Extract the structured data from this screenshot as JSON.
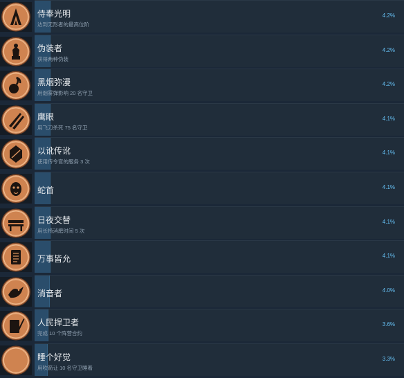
{
  "achievements": [
    {
      "title": "侍奉光明",
      "description": "达到无形者的最高位阶",
      "percent": "4.2%",
      "progress": 0.042,
      "icon": "assassin-crest-icon"
    },
    {
      "title": "伪装者",
      "description": "获得两种伪装",
      "percent": "4.2%",
      "progress": 0.042,
      "icon": "disguise-statue-icon"
    },
    {
      "title": "黑烟弥漫",
      "description": "用烟雾弹影响 20 名守卫",
      "percent": "4.2%",
      "progress": 0.042,
      "icon": "smoke-bomb-icon"
    },
    {
      "title": "鹰眼",
      "description": "用飞刀杀死 75 名守卫",
      "percent": "4.1%",
      "progress": 0.041,
      "icon": "throwing-knives-icon"
    },
    {
      "title": "以讹传讹",
      "description": "使用传令官的服务 3 次",
      "percent": "4.1%",
      "progress": 0.041,
      "icon": "herald-shield-icon"
    },
    {
      "title": "蛇首",
      "description": "",
      "percent": "4.1%",
      "progress": 0.041,
      "icon": "snake-head-icon"
    },
    {
      "title": "日夜交替",
      "description": "用长椅消磨时间 5 次",
      "percent": "4.1%",
      "progress": 0.041,
      "icon": "bench-icon"
    },
    {
      "title": "万事皆允",
      "description": "",
      "percent": "4.1%",
      "progress": 0.041,
      "icon": "scroll-icon"
    },
    {
      "title": "消音者",
      "description": "",
      "percent": "4.0%",
      "progress": 0.04,
      "icon": "silencer-bird-icon"
    },
    {
      "title": "人民捍卫者",
      "description": "完成 10 个阵营合约",
      "percent": "3.6%",
      "progress": 0.036,
      "icon": "contract-quill-icon"
    },
    {
      "title": "睡个好觉",
      "description": "用吹箭让 10 名守卫睡着",
      "percent": "3.3%",
      "progress": 0.033,
      "icon": "crescent-moon-icon"
    }
  ]
}
